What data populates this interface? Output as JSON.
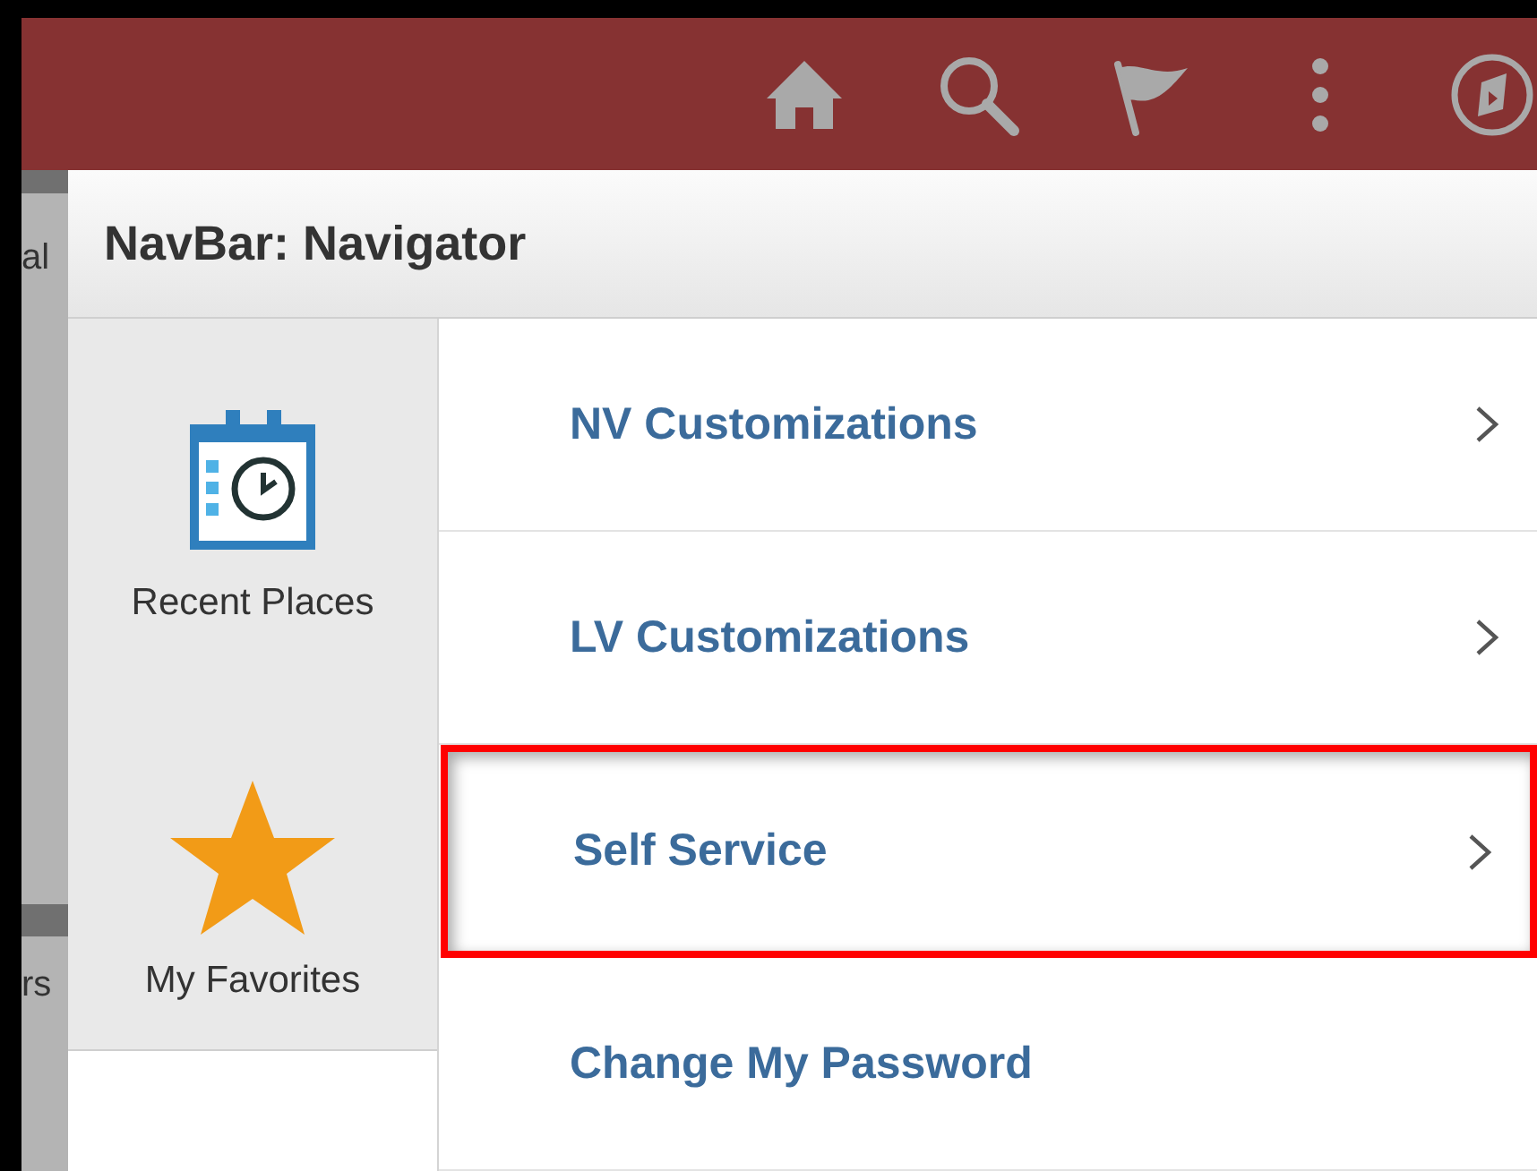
{
  "background_page": {
    "fragments": [
      "al",
      "rs"
    ]
  },
  "panel": {
    "title": "NavBar: Navigator"
  },
  "sidebar": {
    "items": [
      {
        "label": "Recent Places",
        "kind": "recent"
      },
      {
        "label": "My Favorites",
        "kind": "favorites"
      }
    ]
  },
  "menu": {
    "items": [
      {
        "label": "NV Customizations",
        "has_submenu": true,
        "highlighted": false
      },
      {
        "label": "LV Customizations",
        "has_submenu": true,
        "highlighted": false
      },
      {
        "label": "Self Service",
        "has_submenu": true,
        "highlighted": true
      },
      {
        "label": "Change My Password",
        "has_submenu": false,
        "highlighted": false
      }
    ]
  }
}
